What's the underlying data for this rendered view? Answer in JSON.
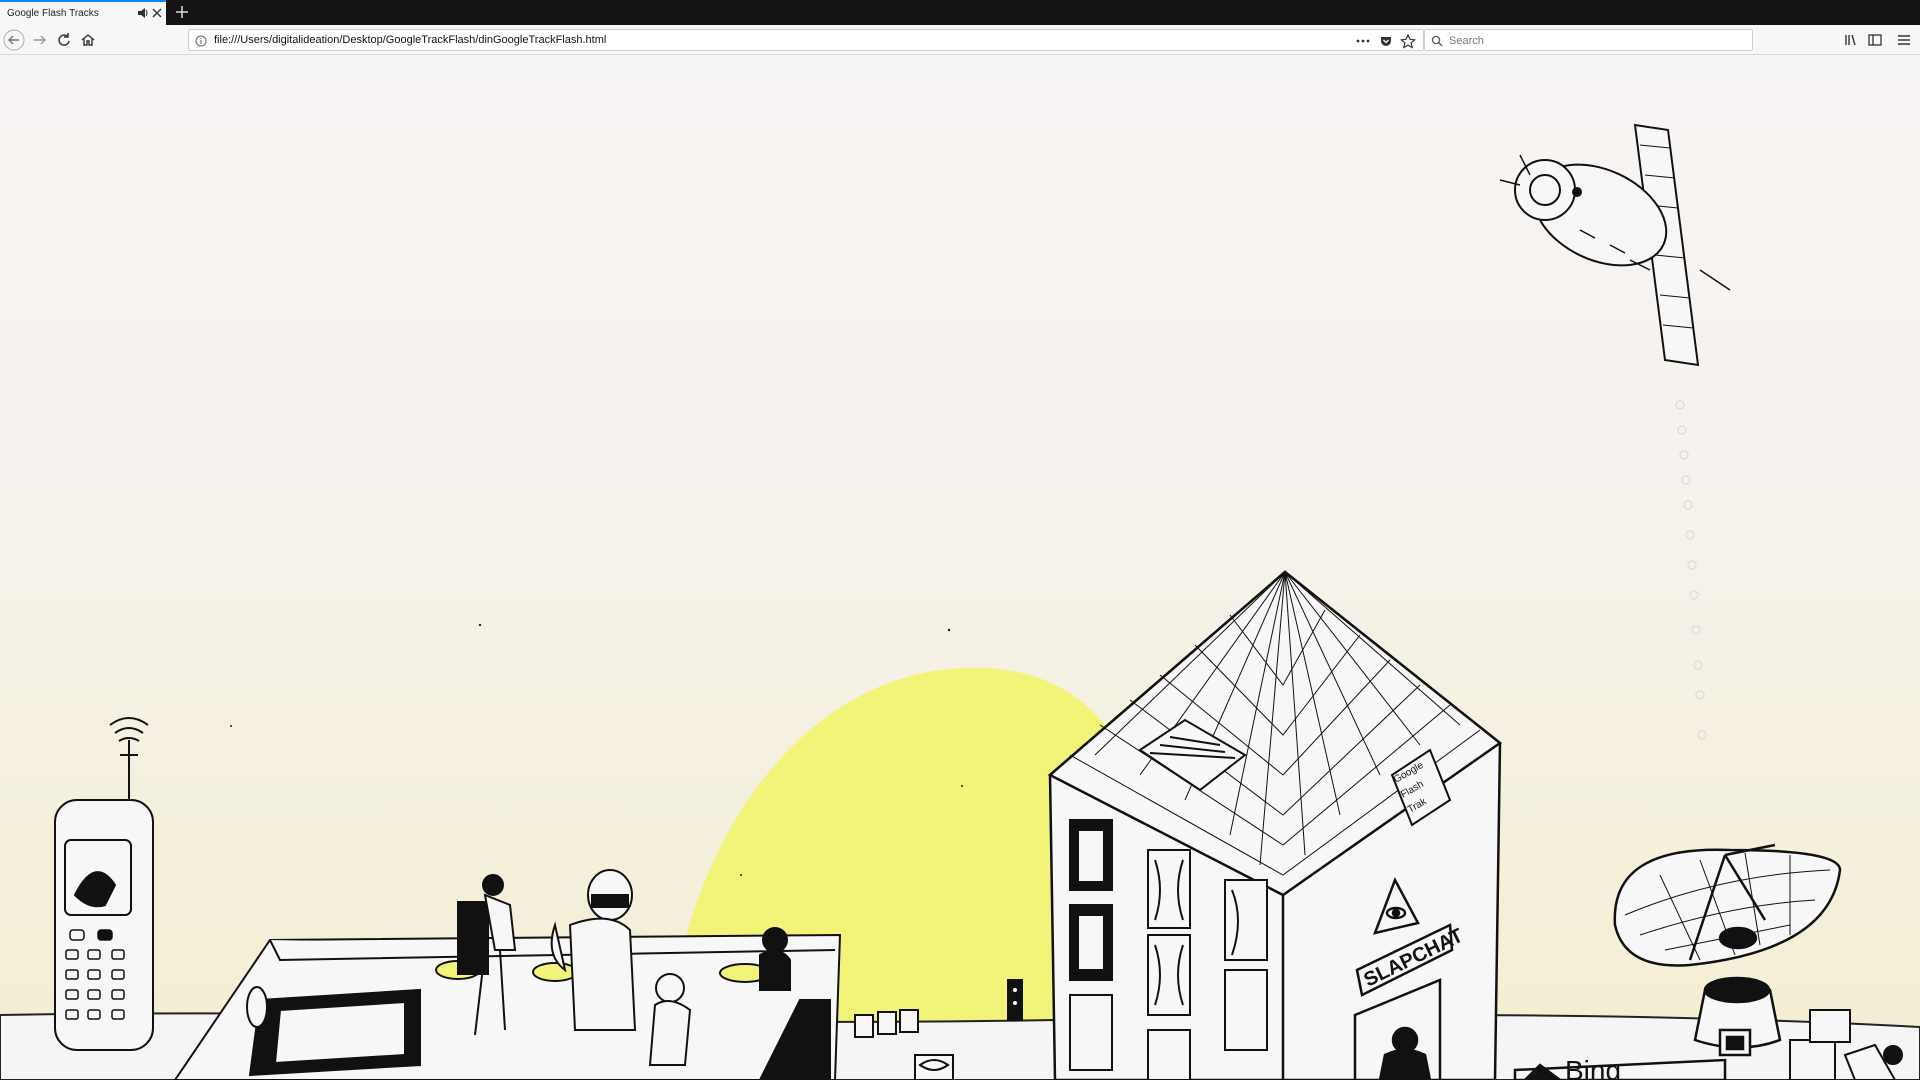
{
  "browser": {
    "tab": {
      "title": "Google Flash Tracks",
      "audio_icon": "speaker-icon",
      "close_icon": "close-icon"
    },
    "new_tab_icon": "plus-icon",
    "nav": {
      "back_icon": "back-arrow-icon",
      "forward_icon": "forward-arrow-icon",
      "reload_icon": "reload-icon",
      "home_icon": "home-icon"
    },
    "url": "file:///Users/digitalideation/Desktop/GoogleTrackFlash/dinGoogleTrackFlash.html",
    "url_actions": [
      "more-dots-icon",
      "pocket-icon",
      "star-icon"
    ],
    "search": {
      "placeholder": "Search"
    },
    "toolbar_right": [
      "library-icon",
      "sidebar-icon",
      "menu-icon"
    ]
  },
  "scene": {
    "colors": {
      "sun": "#f2f47a",
      "sky_top": "#f7f4f4",
      "sky_bottom": "#f4efcf",
      "ink": "#111111"
    },
    "sign_slapchat": "SLAPCHAT",
    "sign_google_flash": [
      "Google",
      "Flash",
      "Trak"
    ],
    "sign_bing": "Bing"
  }
}
